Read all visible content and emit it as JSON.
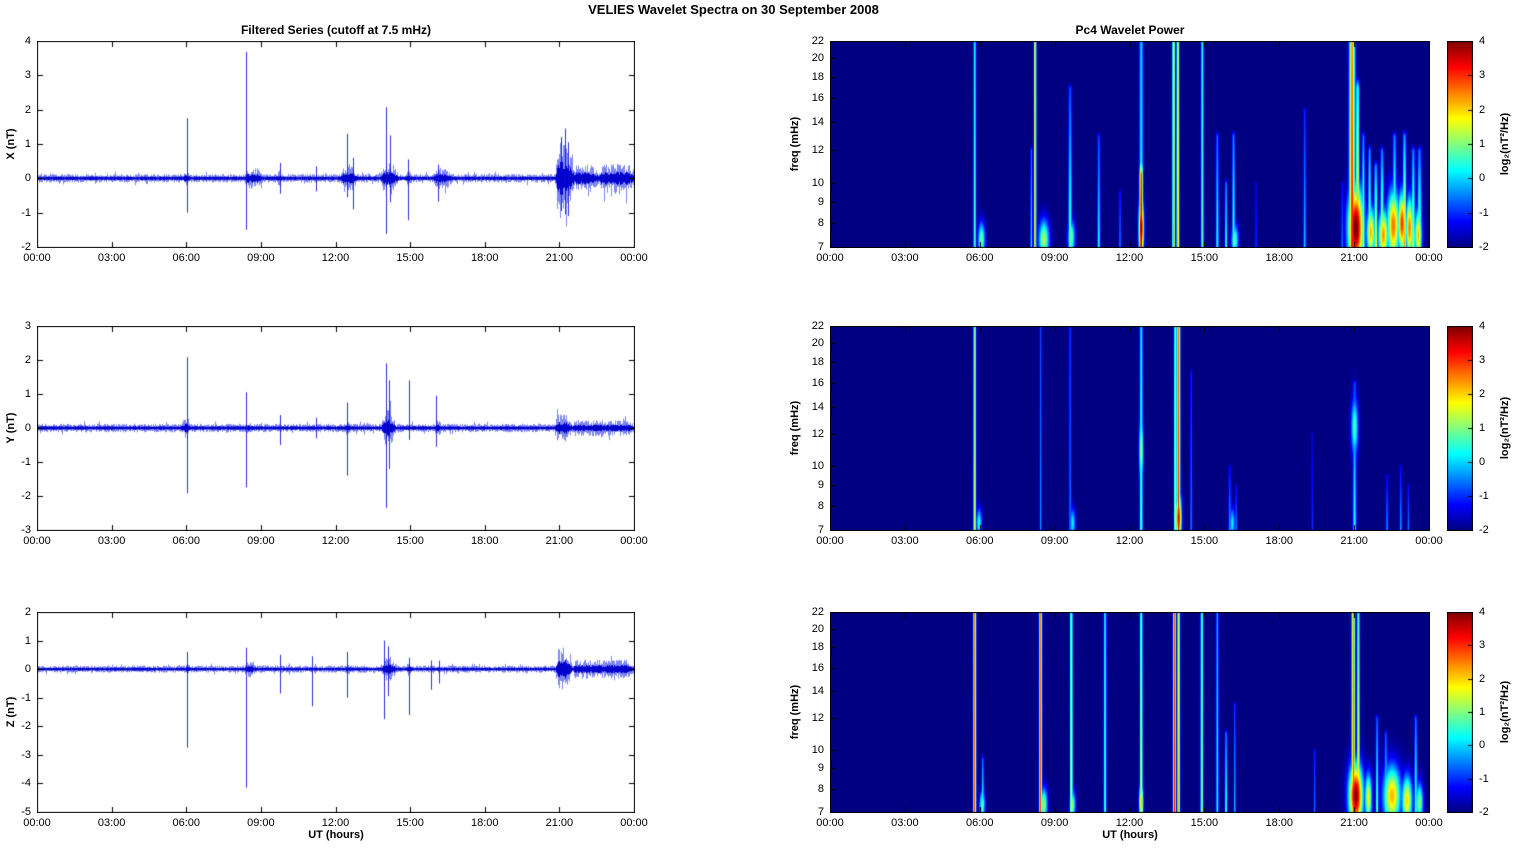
{
  "title": "VELIES Wavelet Spectra on 30 September 2008",
  "left_column_title": "Filtered Series (cutoff at 7.5 mHz)",
  "right_column_title": "Pc4 Wavelet Power",
  "xlabel": "UT (hours)",
  "line_color": "#0000e0",
  "x_tick_hours": [
    0,
    3,
    6,
    9,
    12,
    15,
    18,
    21,
    24
  ],
  "x_tick_labels": [
    "00:00",
    "03:00",
    "06:00",
    "09:00",
    "12:00",
    "15:00",
    "18:00",
    "21:00",
    "00:00"
  ],
  "colorbar": {
    "label": "log₂(nT²/Hz)",
    "ticks": [
      -2,
      -1,
      0,
      1,
      2,
      3,
      4
    ],
    "lim": [
      -2,
      4
    ],
    "colormap": "jet"
  },
  "chart_data": [
    {
      "id": "x-series",
      "type": "line",
      "row": 0,
      "col": "left",
      "title": "Filtered Series (cutoff at 7.5 mHz)",
      "ylabel": "X (nT)",
      "ylim": [
        -2,
        4
      ],
      "yticks": [
        -2,
        -1,
        0,
        1,
        2,
        3,
        4
      ],
      "xlim_hours": [
        0,
        24
      ],
      "noise_base": 0.09,
      "noise_segments": [
        {
          "t0": 5.85,
          "t1": 6.2,
          "amp": 0.2
        },
        {
          "t0": 8.3,
          "t1": 9.1,
          "amp": 0.22
        },
        {
          "t0": 9.6,
          "t1": 9.95,
          "amp": 0.18
        },
        {
          "t0": 12.2,
          "t1": 12.85,
          "amp": 0.3
        },
        {
          "t0": 13.8,
          "t1": 14.5,
          "amp": 0.34
        },
        {
          "t0": 14.8,
          "t1": 15.1,
          "amp": 0.2
        },
        {
          "t0": 15.9,
          "t1": 16.7,
          "amp": 0.22
        },
        {
          "t0": 20.85,
          "t1": 21.55,
          "amp": 0.85
        },
        {
          "t0": 21.55,
          "t1": 22.6,
          "amp": 0.3
        },
        {
          "t0": 22.6,
          "t1": 24.0,
          "amp": 0.33
        }
      ],
      "spikes": [
        {
          "t": 6.02,
          "up": 1.75,
          "down": -1.0
        },
        {
          "t": 8.42,
          "up": 3.68,
          "down": -1.5
        },
        {
          "t": 9.75,
          "up": 0.45,
          "down": -0.45
        },
        {
          "t": 11.2,
          "up": 0.35,
          "down": -0.38
        },
        {
          "t": 12.48,
          "up": 1.3,
          "down": -0.55
        },
        {
          "t": 12.72,
          "up": 0.6,
          "down": -0.9
        },
        {
          "t": 14.02,
          "up": 2.07,
          "down": -1.62
        },
        {
          "t": 14.18,
          "up": 1.25,
          "down": -0.7
        },
        {
          "t": 14.92,
          "up": 0.55,
          "down": -1.22
        },
        {
          "t": 16.12,
          "up": 0.4,
          "down": -0.68
        },
        {
          "t": 21.05,
          "up": 1.2,
          "down": -0.95
        },
        {
          "t": 21.22,
          "up": 1.45,
          "down": -1.05
        },
        {
          "t": 21.35,
          "up": 1.05,
          "down": -1.1
        }
      ]
    },
    {
      "id": "y-series",
      "type": "line",
      "row": 1,
      "col": "left",
      "ylabel": "Y (nT)",
      "ylim": [
        -3,
        3
      ],
      "yticks": [
        -3,
        -2,
        -1,
        0,
        1,
        2,
        3
      ],
      "xlim_hours": [
        0,
        24
      ],
      "noise_base": 0.09,
      "noise_segments": [
        {
          "t0": 5.8,
          "t1": 6.2,
          "amp": 0.22
        },
        {
          "t0": 8.3,
          "t1": 8.7,
          "amp": 0.15
        },
        {
          "t0": 12.35,
          "t1": 12.65,
          "amp": 0.2
        },
        {
          "t0": 13.85,
          "t1": 14.4,
          "amp": 0.42
        },
        {
          "t0": 15.95,
          "t1": 16.35,
          "amp": 0.18
        },
        {
          "t0": 20.8,
          "t1": 21.5,
          "amp": 0.3
        },
        {
          "t0": 21.5,
          "t1": 24.0,
          "amp": 0.17
        }
      ],
      "spikes": [
        {
          "t": 6.02,
          "up": 2.08,
          "down": -1.92
        },
        {
          "t": 8.42,
          "up": 1.05,
          "down": -1.75
        },
        {
          "t": 9.75,
          "up": 0.38,
          "down": -0.5
        },
        {
          "t": 11.2,
          "up": 0.3,
          "down": -0.3
        },
        {
          "t": 12.48,
          "up": 0.75,
          "down": -1.4
        },
        {
          "t": 14.02,
          "up": 1.9,
          "down": -2.35
        },
        {
          "t": 14.15,
          "up": 1.4,
          "down": -1.2
        },
        {
          "t": 14.95,
          "up": 1.4,
          "down": -0.35
        },
        {
          "t": 16.05,
          "up": 0.95,
          "down": -0.55
        }
      ]
    },
    {
      "id": "z-series",
      "type": "line",
      "row": 2,
      "col": "left",
      "ylabel": "Z (nT)",
      "ylim": [
        -5,
        2
      ],
      "yticks": [
        -5,
        -4,
        -3,
        -2,
        -1,
        0,
        1,
        2
      ],
      "xlim_hours": [
        0,
        24
      ],
      "noise_base": 0.09,
      "noise_segments": [
        {
          "t0": 5.9,
          "t1": 6.2,
          "amp": 0.18
        },
        {
          "t0": 8.3,
          "t1": 8.85,
          "amp": 0.2
        },
        {
          "t0": 9.6,
          "t1": 9.9,
          "amp": 0.15
        },
        {
          "t0": 12.35,
          "t1": 12.7,
          "amp": 0.18
        },
        {
          "t0": 13.85,
          "t1": 14.45,
          "amp": 0.3
        },
        {
          "t0": 14.8,
          "t1": 15.15,
          "amp": 0.18
        },
        {
          "t0": 20.85,
          "t1": 21.5,
          "amp": 0.55
        },
        {
          "t0": 21.5,
          "t1": 24.0,
          "amp": 0.24
        }
      ],
      "spikes": [
        {
          "t": 6.02,
          "up": 0.6,
          "down": -2.75
        },
        {
          "t": 8.42,
          "up": 0.75,
          "down": -4.15
        },
        {
          "t": 9.75,
          "up": 0.5,
          "down": -0.85
        },
        {
          "t": 11.05,
          "up": 0.45,
          "down": -1.3
        },
        {
          "t": 12.48,
          "up": 0.6,
          "down": -1.0
        },
        {
          "t": 13.95,
          "up": 1.0,
          "down": -1.75
        },
        {
          "t": 14.12,
          "up": 0.8,
          "down": -0.95
        },
        {
          "t": 14.95,
          "up": 0.4,
          "down": -1.6
        },
        {
          "t": 15.82,
          "up": 0.3,
          "down": -0.72
        },
        {
          "t": 16.15,
          "up": 0.3,
          "down": -0.5
        }
      ]
    },
    {
      "id": "x-wavelet",
      "type": "heatmap",
      "row": 0,
      "col": "right",
      "title": "Pc4 Wavelet Power",
      "ylabel": "freq (mHz)",
      "flim": [
        7,
        22
      ],
      "yscale": "log",
      "yticks": [
        7,
        8,
        9,
        10,
        12,
        14,
        16,
        18,
        20,
        22
      ],
      "clim": [
        -2,
        4
      ],
      "streaks": [
        {
          "t": 5.78,
          "s": 0.04,
          "pb": 0.7,
          "pt": 0.3,
          "ftop": 22
        },
        {
          "t": 8.05,
          "s": 0.03,
          "pb": 0.3,
          "pt": -0.6,
          "ftop": 12
        },
        {
          "t": 8.2,
          "s": 0.035,
          "pb": 2.6,
          "pt": 2.2,
          "ftop": 22
        },
        {
          "t": 9.6,
          "s": 0.05,
          "pb": 1.0,
          "pt": -0.8,
          "ftop": 17
        },
        {
          "t": 10.75,
          "s": 0.04,
          "pb": 0.5,
          "pt": -0.8,
          "ftop": 13
        },
        {
          "t": 11.6,
          "s": 0.03,
          "pb": -0.4,
          "pt": -1.0,
          "ftop": 9.5
        },
        {
          "t": 12.45,
          "s": 0.05,
          "pb": 3.8,
          "pt": 3.0,
          "ftop": 10.5
        },
        {
          "t": 12.45,
          "s": 0.055,
          "pb": 0.4,
          "pt": 0.0,
          "ftop": 22
        },
        {
          "t": 13.75,
          "s": 0.04,
          "pb": 2.3,
          "pt": 1.8,
          "ftop": 22
        },
        {
          "t": 13.92,
          "s": 0.04,
          "pb": 2.4,
          "pt": 1.6,
          "ftop": 22
        },
        {
          "t": 14.9,
          "s": 0.04,
          "pb": 0.9,
          "pt": 0.4,
          "ftop": 22
        },
        {
          "t": 15.5,
          "s": 0.04,
          "pb": 0.6,
          "pt": -0.6,
          "ftop": 13
        },
        {
          "t": 15.85,
          "s": 0.035,
          "pb": 0.7,
          "pt": -0.5,
          "ftop": 10
        },
        {
          "t": 16.15,
          "s": 0.04,
          "pb": 0.9,
          "pt": -0.4,
          "ftop": 13
        },
        {
          "t": 17.05,
          "s": 0.03,
          "pb": -0.8,
          "pt": -1.4,
          "ftop": 10
        },
        {
          "t": 19.0,
          "s": 0.04,
          "pb": 0.0,
          "pt": -1.0,
          "ftop": 15
        },
        {
          "t": 20.5,
          "s": 0.03,
          "pb": -0.4,
          "pt": -1.2,
          "ftop": 10
        },
        {
          "t": 20.9,
          "s": 0.08,
          "pb": 3.3,
          "pt": 2.4,
          "ftop": 22
        },
        {
          "t": 21.12,
          "s": 0.05,
          "pb": 2.8,
          "pt": 0.8,
          "ftop": 17
        },
        {
          "t": 21.35,
          "s": 0.04,
          "pb": 1.8,
          "pt": -0.5,
          "ftop": 13
        },
        {
          "t": 21.6,
          "s": 0.04,
          "pb": 2.0,
          "pt": -0.3,
          "ftop": 12
        },
        {
          "t": 21.85,
          "s": 0.05,
          "pb": 2.2,
          "pt": -0.3,
          "ftop": 11
        },
        {
          "t": 22.1,
          "s": 0.05,
          "pb": 2.0,
          "pt": -0.5,
          "ftop": 12
        },
        {
          "t": 22.6,
          "s": 0.05,
          "pb": 1.5,
          "pt": -0.5,
          "ftop": 13
        },
        {
          "t": 23.0,
          "s": 0.05,
          "pb": 2.5,
          "pt": -0.3,
          "ftop": 13
        },
        {
          "t": 23.35,
          "s": 0.05,
          "pb": 1.8,
          "pt": -0.5,
          "ftop": 12
        },
        {
          "t": 23.6,
          "s": 0.06,
          "pb": 1.5,
          "pt": -0.6,
          "ftop": 12
        }
      ],
      "blobs": [
        {
          "t": 6.05,
          "st": 0.1,
          "f0": 7.3,
          "sf": 0.07,
          "p": 1.0
        },
        {
          "t": 8.55,
          "st": 0.15,
          "f0": 7.3,
          "sf": 0.08,
          "p": 1.3
        },
        {
          "t": 9.65,
          "st": 0.1,
          "f0": 7.4,
          "sf": 0.07,
          "p": 0.9
        },
        {
          "t": 12.45,
          "st": 0.07,
          "f0": 7.8,
          "sf": 0.12,
          "p": 4.0
        },
        {
          "t": 16.2,
          "st": 0.1,
          "f0": 7.3,
          "sf": 0.06,
          "p": 0.8
        },
        {
          "t": 21.05,
          "st": 0.22,
          "f0": 7.8,
          "sf": 0.16,
          "p": 4.2
        },
        {
          "t": 21.65,
          "st": 0.12,
          "f0": 7.6,
          "sf": 0.1,
          "p": 2.2
        },
        {
          "t": 22.15,
          "st": 0.15,
          "f0": 7.5,
          "sf": 0.1,
          "p": 2.4
        },
        {
          "t": 22.55,
          "st": 0.18,
          "f0": 7.9,
          "sf": 0.14,
          "p": 2.6
        },
        {
          "t": 22.9,
          "st": 0.12,
          "f0": 8.0,
          "sf": 0.12,
          "p": 3.0
        },
        {
          "t": 23.2,
          "st": 0.1,
          "f0": 7.8,
          "sf": 0.12,
          "p": 2.6
        },
        {
          "t": 23.55,
          "st": 0.1,
          "f0": 7.5,
          "sf": 0.1,
          "p": 2.2
        }
      ]
    },
    {
      "id": "y-wavelet",
      "type": "heatmap",
      "row": 1,
      "col": "right",
      "ylabel": "freq (mHz)",
      "flim": [
        7,
        22
      ],
      "yscale": "log",
      "yticks": [
        7,
        8,
        9,
        10,
        12,
        14,
        16,
        18,
        20,
        22
      ],
      "clim": [
        -2,
        4
      ],
      "streaks": [
        {
          "t": 5.78,
          "s": 0.04,
          "pb": 1.6,
          "pt": 1.2,
          "ftop": 22
        },
        {
          "t": 8.42,
          "s": 0.03,
          "pb": -0.3,
          "pt": -0.8,
          "ftop": 22
        },
        {
          "t": 9.6,
          "s": 0.035,
          "pb": -0.5,
          "pt": -0.9,
          "ftop": 22
        },
        {
          "t": 12.45,
          "s": 0.045,
          "pb": 0.9,
          "pt": 0.2,
          "ftop": 22
        },
        {
          "t": 13.82,
          "s": 0.04,
          "pb": 1.8,
          "pt": 1.2,
          "ftop": 22
        },
        {
          "t": 13.95,
          "s": 0.045,
          "pb": 3.2,
          "pt": 2.6,
          "ftop": 22
        },
        {
          "t": 14.45,
          "s": 0.03,
          "pb": -0.4,
          "pt": -1.0,
          "ftop": 17
        },
        {
          "t": 16.0,
          "s": 0.04,
          "pb": -0.2,
          "pt": -1.2,
          "ftop": 10
        },
        {
          "t": 16.25,
          "s": 0.03,
          "pb": -0.3,
          "pt": -1.2,
          "ftop": 9
        },
        {
          "t": 19.3,
          "s": 0.025,
          "pb": -0.8,
          "pt": -1.4,
          "ftop": 12
        },
        {
          "t": 21.0,
          "s": 0.05,
          "pb": 0.5,
          "pt": -0.8,
          "ftop": 16
        },
        {
          "t": 22.3,
          "s": 0.035,
          "pb": -0.3,
          "pt": -1.2,
          "ftop": 9.5
        },
        {
          "t": 22.85,
          "s": 0.035,
          "pb": -0.2,
          "pt": -1.2,
          "ftop": 10
        },
        {
          "t": 23.15,
          "s": 0.03,
          "pb": -0.4,
          "pt": -1.2,
          "ftop": 9
        }
      ],
      "blobs": [
        {
          "t": 5.95,
          "st": 0.08,
          "f0": 7.3,
          "sf": 0.06,
          "p": 0.4
        },
        {
          "t": 9.7,
          "st": 0.08,
          "f0": 7.3,
          "sf": 0.06,
          "p": 0.2
        },
        {
          "t": 12.45,
          "st": 0.06,
          "f0": 11.0,
          "sf": 0.14,
          "p": 1.3
        },
        {
          "t": 13.95,
          "st": 0.08,
          "f0": 7.5,
          "sf": 0.1,
          "p": 3.4
        },
        {
          "t": 16.1,
          "st": 0.08,
          "f0": 7.3,
          "sf": 0.06,
          "p": 0.2
        },
        {
          "t": 21.0,
          "st": 0.1,
          "f0": 12.5,
          "sf": 0.12,
          "p": 0.7
        }
      ]
    },
    {
      "id": "z-wavelet",
      "type": "heatmap",
      "row": 2,
      "col": "right",
      "ylabel": "freq (mHz)",
      "flim": [
        7,
        22
      ],
      "yscale": "log",
      "yticks": [
        7,
        8,
        9,
        10,
        12,
        14,
        16,
        18,
        20,
        22
      ],
      "clim": [
        -2,
        4
      ],
      "streaks": [
        {
          "t": 5.78,
          "s": 0.04,
          "pb": 3.0,
          "pt": 2.6,
          "ftop": 22
        },
        {
          "t": 6.1,
          "s": 0.035,
          "pb": 0.8,
          "pt": -0.6,
          "ftop": 9.5
        },
        {
          "t": 8.42,
          "s": 0.04,
          "pb": 3.0,
          "pt": 2.6,
          "ftop": 22
        },
        {
          "t": 9.65,
          "s": 0.04,
          "pb": 1.8,
          "pt": 1.2,
          "ftop": 22
        },
        {
          "t": 11.0,
          "s": 0.04,
          "pb": 0.8,
          "pt": 0.3,
          "ftop": 22
        },
        {
          "t": 12.45,
          "s": 0.04,
          "pb": 1.9,
          "pt": 1.0,
          "ftop": 22
        },
        {
          "t": 13.78,
          "s": 0.04,
          "pb": 3.3,
          "pt": 2.8,
          "ftop": 22
        },
        {
          "t": 13.95,
          "s": 0.04,
          "pb": 2.2,
          "pt": 1.5,
          "ftop": 22
        },
        {
          "t": 14.88,
          "s": 0.04,
          "pb": 1.4,
          "pt": 0.9,
          "ftop": 22
        },
        {
          "t": 15.5,
          "s": 0.035,
          "pb": 0.5,
          "pt": -0.2,
          "ftop": 22
        },
        {
          "t": 15.85,
          "s": 0.035,
          "pb": 0.8,
          "pt": -0.5,
          "ftop": 11
        },
        {
          "t": 16.2,
          "s": 0.03,
          "pb": 0.0,
          "pt": -0.9,
          "ftop": 13
        },
        {
          "t": 19.4,
          "s": 0.03,
          "pb": -0.5,
          "pt": -1.1,
          "ftop": 10
        },
        {
          "t": 20.95,
          "s": 0.05,
          "pb": 2.9,
          "pt": 2.3,
          "ftop": 22
        },
        {
          "t": 21.15,
          "s": 0.04,
          "pb": 2.0,
          "pt": 0.8,
          "ftop": 22
        },
        {
          "t": 21.9,
          "s": 0.04,
          "pb": 1.0,
          "pt": -0.7,
          "ftop": 12
        },
        {
          "t": 22.25,
          "s": 0.04,
          "pb": 0.8,
          "pt": -0.8,
          "ftop": 11
        },
        {
          "t": 23.45,
          "s": 0.04,
          "pb": 1.0,
          "pt": -0.6,
          "ftop": 12
        }
      ],
      "blobs": [
        {
          "t": 6.08,
          "st": 0.08,
          "f0": 7.3,
          "sf": 0.06,
          "p": 0.8
        },
        {
          "t": 8.55,
          "st": 0.1,
          "f0": 7.3,
          "sf": 0.07,
          "p": 1.2
        },
        {
          "t": 9.7,
          "st": 0.08,
          "f0": 7.3,
          "sf": 0.06,
          "p": 1.0
        },
        {
          "t": 12.45,
          "st": 0.06,
          "f0": 7.4,
          "sf": 0.08,
          "p": 2.2
        },
        {
          "t": 21.05,
          "st": 0.2,
          "f0": 7.7,
          "sf": 0.13,
          "p": 4.0
        },
        {
          "t": 21.55,
          "st": 0.1,
          "f0": 7.6,
          "sf": 0.1,
          "p": 1.8
        },
        {
          "t": 22.5,
          "st": 0.25,
          "f0": 7.7,
          "sf": 0.12,
          "p": 2.2
        },
        {
          "t": 23.1,
          "st": 0.15,
          "f0": 7.5,
          "sf": 0.1,
          "p": 2.0
        },
        {
          "t": 23.6,
          "st": 0.1,
          "f0": 7.4,
          "sf": 0.08,
          "p": 1.2
        }
      ]
    }
  ]
}
